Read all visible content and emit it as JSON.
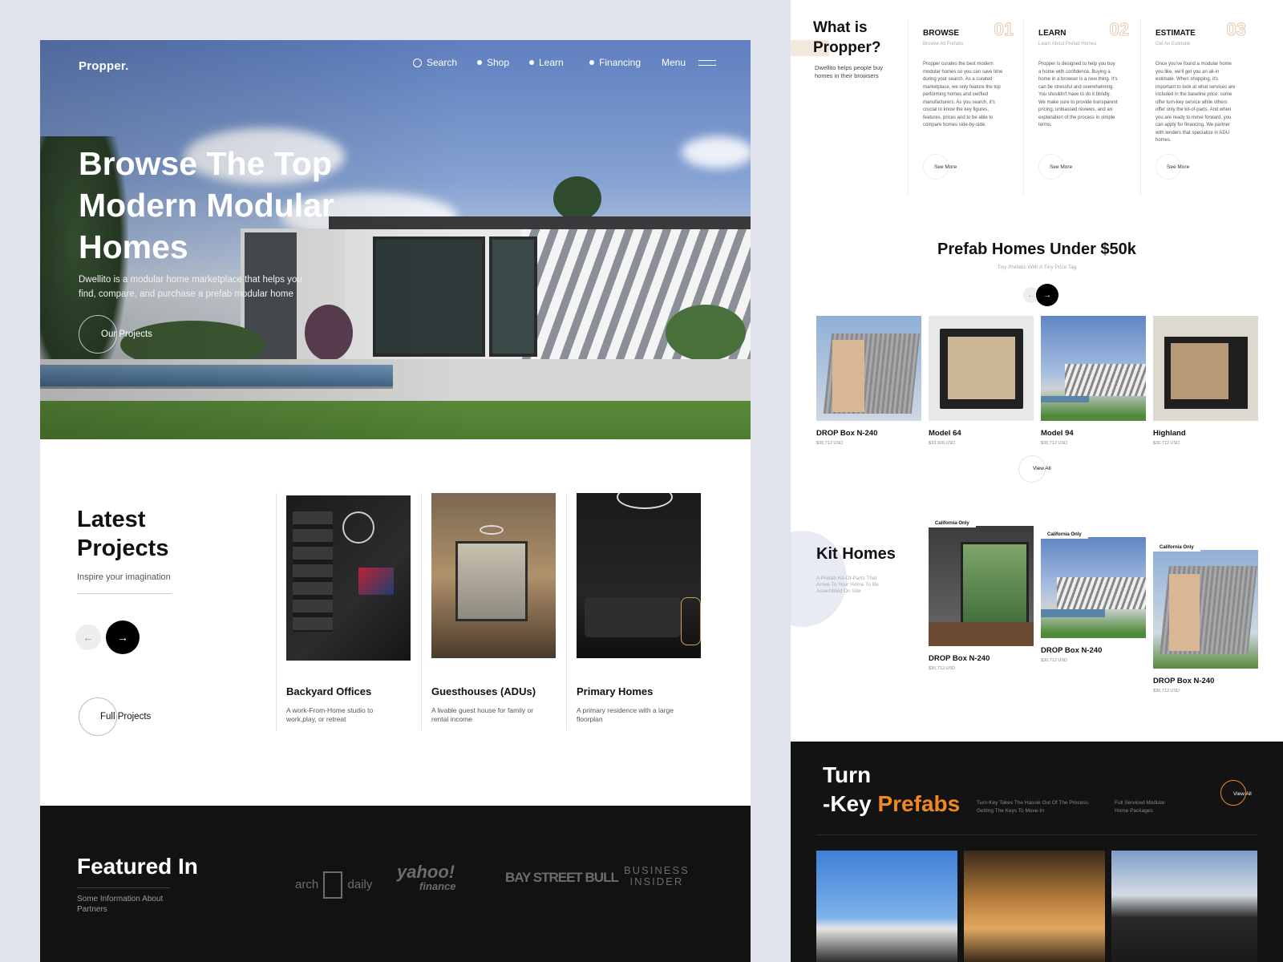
{
  "brand": "Propper.",
  "nav": {
    "search": "Search",
    "shop": "Shop",
    "learn": "Learn",
    "financing": "Financing",
    "menu": "Menu"
  },
  "hero": {
    "title": "Browse The Top Modern Modular Homes",
    "subtitle": "Dwellito is a modular home marketplace that helps you find, compare, and purchase a prefab modular home",
    "cta": "Our Projects"
  },
  "latest": {
    "title": "Latest Projects",
    "subtitle": "Inspire your imagination",
    "full_label": "Full Projects",
    "items": [
      {
        "name": "Backyard Offices",
        "desc": "A work-From-Home studio to work,play, or retreat"
      },
      {
        "name": "Guesthouses (ADUs)",
        "desc": "A livable guest house for family or rental income"
      },
      {
        "name": "Primary Homes",
        "desc": "A primary residence with a large floorplan"
      }
    ]
  },
  "featured": {
    "title": "Featured In",
    "subtitle": "Some Information About Partners",
    "logos": [
      "arch",
      "daily",
      "yahoo!",
      "finance",
      "BAY STREET BULL",
      "BUSINESS",
      "INSIDER"
    ]
  },
  "what": {
    "title_l1": "What is",
    "title_l2": "Propper?",
    "subtitle": "Dwellito helps people buy homes in their browsers",
    "see_more": "See More",
    "columns": [
      {
        "title": "BROWSE",
        "num": "01",
        "sub": "Browse All Prefabs",
        "body": "Propper curates the best modern modular homes so you can save time during your search. As a curated marketplace, we only feature the top performing homes and verified manufacturers. As you search, it's crucial to know the key figures, features, prices and to be able to compare homes side-by-side."
      },
      {
        "title": "LEARN",
        "num": "02",
        "sub": "Learn About Prefab Homes",
        "body": "Propper is designed to help you buy a home with confidence. Buying a home in a browser is a new thing. It's can be stressful and overwhelming. You shouldn't have to do it blindly. We make sure to provide transparent pricing, unbiassed reviews, and an explanation of the process in simple terms."
      },
      {
        "title": "ESTIMATE",
        "num": "03",
        "sub": "Get An Estimate",
        "body": "Once you've found a modular home you like, we'll get you an all-in estimate. When shopping, it's important to look at what services are included in the baseline price: some offer turn-key service while others offer only the kit-of-parts. And when you are ready to move forward, you can apply for financing. We partner with lenders that specialize in ADU homes."
      }
    ]
  },
  "prefab": {
    "title": "Prefab Homes Under $50k",
    "subtitle": "Tiny Prefabs With A Tiny Price Tag",
    "view_all": "View All",
    "items": [
      {
        "name": "DROP Box N-240",
        "price": "$30,712 USD"
      },
      {
        "name": "Model 64",
        "price": "$33,926 USD"
      },
      {
        "name": "Model 94",
        "price": "$30,712 USD"
      },
      {
        "name": "Highland",
        "price": "$30,712 USD"
      }
    ]
  },
  "kit": {
    "title": "Kit Homes",
    "subtitle": "A Prefab Kit-Of-Parts That Arrive To Your Home To Be Assembled On Site",
    "tag": "California Only",
    "items": [
      {
        "name": "DROP Box N-240",
        "price": "$30,712 USD"
      },
      {
        "name": "DROP Box N-240",
        "price": "$30,712 USD"
      },
      {
        "name": "DROP Box N-240",
        "price": "$30,712 USD"
      }
    ]
  },
  "turnkey": {
    "title_l1": "Turn",
    "title_l2a": "-Key ",
    "title_l2b": "Prefabs",
    "text1": "Turn-Key Takes The Hassle Out Of The Process. Getting The Keys To Move-In",
    "text2": "Full Serviced Modular Home Packages",
    "view_all": "View All"
  },
  "colors": {
    "accent": "#f08a1e",
    "dark": "#121212",
    "bg": "#e1e3ec"
  }
}
